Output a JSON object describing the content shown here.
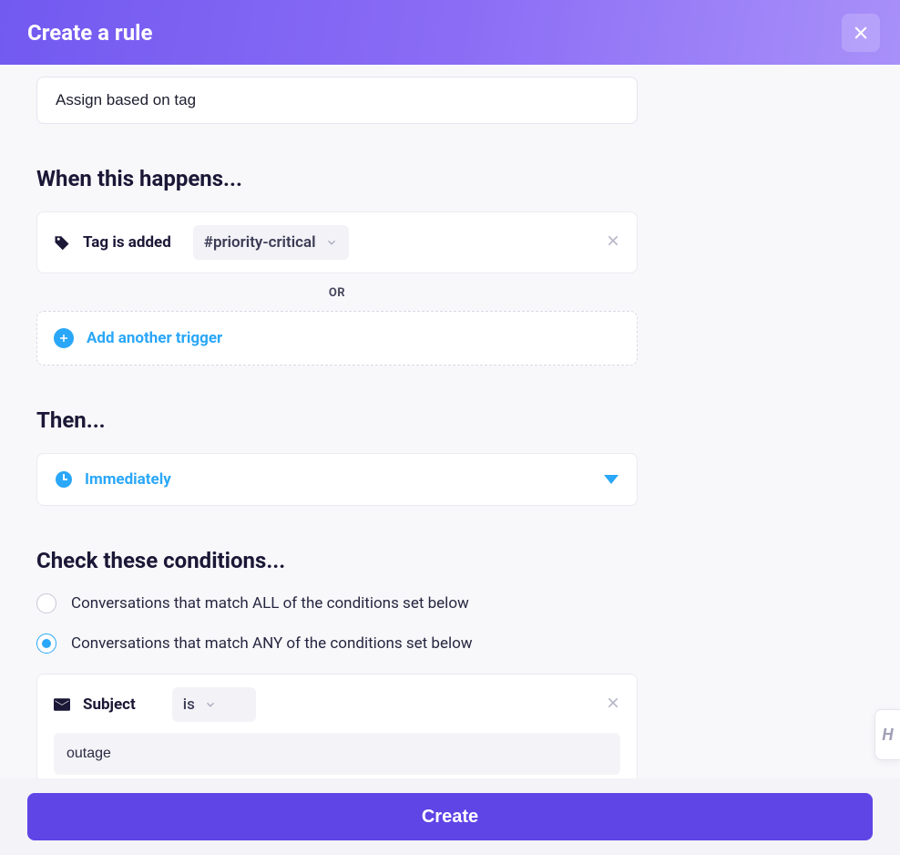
{
  "header": {
    "title": "Create a rule"
  },
  "rule_name": "Assign based on tag",
  "sections": {
    "when_title": "When this happens...",
    "then_title": "Then...",
    "conditions_title": "Check these conditions..."
  },
  "trigger": {
    "type_label": "Tag is added",
    "value": "#priority-critical",
    "separator": "OR",
    "add_label": "Add another trigger"
  },
  "timing": {
    "label": "Immediately"
  },
  "conditions": {
    "match_all_label": "Conversations that match ALL of the conditions set below",
    "match_any_label": "Conversations that match ANY of the conditions set below",
    "selected": "any",
    "items": [
      {
        "field_label": "Subject",
        "operator": "is",
        "value": "outage"
      }
    ]
  },
  "footer": {
    "submit_label": "Create"
  }
}
